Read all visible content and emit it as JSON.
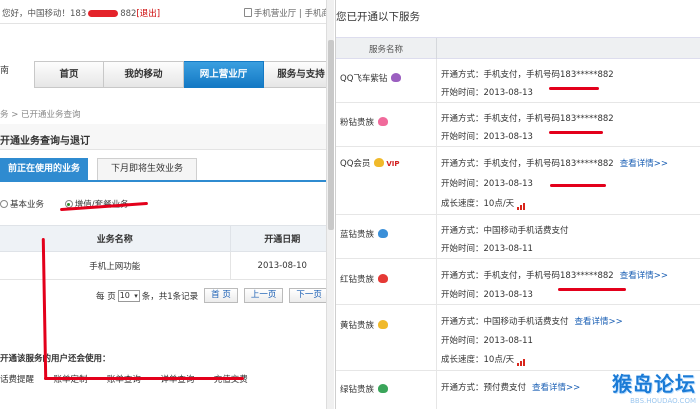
{
  "left": {
    "welcome_text": "您好，中国移动！183",
    "welcome_masked_suffix": "882",
    "logout_label": "[退出]",
    "top_links": "手机营业厅 | 手机商",
    "nav_cut": "南",
    "nav_tabs": [
      {
        "label": "首页",
        "active": false
      },
      {
        "label": "我的移动",
        "active": false
      },
      {
        "label": "网上营业厅",
        "active": true
      },
      {
        "label": "服务与支持",
        "active": false
      }
    ],
    "breadcrumb": "务 > 已开通业务查询",
    "section_title": "开通业务查询与退订",
    "subtabs": [
      {
        "label": "前正在使用的业务",
        "active": true
      },
      {
        "label": "下月即将生效业务",
        "active": false
      }
    ],
    "radio_basic": "基本业务",
    "radio_value_added": "增值/套餐业务",
    "table_headers": [
      "业务名称",
      "开通日期"
    ],
    "table_rows": [
      {
        "name": "手机上网功能",
        "date": "2013-08-10"
      }
    ],
    "pager": {
      "per_page_label": "每 页",
      "per_page_value": "10",
      "summary": "条，共1条记录",
      "first": "首 页",
      "prev": "上一页",
      "next": "下一页"
    },
    "also_title": "开通该服务的用户还会使用：",
    "also_links": [
      "话费提醒",
      "账单定制",
      "账单查询",
      "详单查询",
      "充值交费"
    ]
  },
  "right": {
    "title": "您已开通以下服务",
    "column_header": "服务名称",
    "services": [
      {
        "name": "QQ飞车紫钻",
        "badge": "purple-diamond-icon",
        "method": "开通方式：手机支付，手机号码183*****882",
        "start": "开始时间：2013-08-13",
        "more": "",
        "growth": ""
      },
      {
        "name": "粉钻贵族",
        "badge": "pink-diamond-icon",
        "method": "开通方式：手机支付，手机号码183*****882",
        "start": "开始时间：2013-08-13",
        "more": "",
        "growth": ""
      },
      {
        "name": "QQ会员",
        "badge": "qq-member-icon",
        "method": "开通方式：手机支付，手机号码183*****882",
        "start": "开始时间：2013-08-13",
        "more": "查看详情>>",
        "growth": "成长速度：10点/天"
      },
      {
        "name": "蓝钻贵族",
        "badge": "blue-diamond-icon",
        "method": "开通方式：中国移动手机话费支付",
        "start": "开始时间：2013-08-11",
        "more": "",
        "growth": ""
      },
      {
        "name": "红钻贵族",
        "badge": "red-diamond-icon",
        "method": "开通方式：手机支付，手机号码183*****882",
        "start": "开始时间：2013-08-13",
        "more": "查看详情>>",
        "growth": ""
      },
      {
        "name": "黄钻贵族",
        "badge": "yellow-diamond-icon",
        "method": "开通方式：中国移动手机话费支付",
        "start": "开始时间：2013-08-11",
        "more": "查看详情>>",
        "growth": "成长速度：10点/天"
      },
      {
        "name": "绿钻贵族",
        "badge": "green-diamond-icon",
        "method": "开通方式：预付费支付",
        "start": "",
        "more": "查看详情>>",
        "growth": ""
      }
    ],
    "vip_label": "VIP",
    "watermark": "猴岛论坛",
    "watermark_url": "BBS.HOUDAO.COM"
  },
  "colors": {
    "nav_active": "#1479c4",
    "annotation_red": "#e3001b",
    "link_blue": "#1a5fb4"
  }
}
